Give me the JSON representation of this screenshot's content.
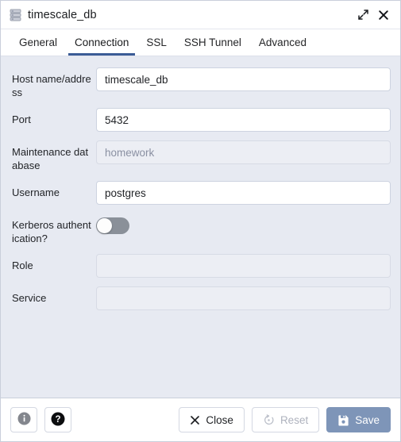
{
  "window": {
    "title": "timescale_db",
    "icon": "database-stack-icon",
    "expand_label": "expand",
    "close_label": "close"
  },
  "tabs": [
    {
      "label": "General",
      "active": false
    },
    {
      "label": "Connection",
      "active": true
    },
    {
      "label": "SSL",
      "active": false
    },
    {
      "label": "SSH Tunnel",
      "active": false
    },
    {
      "label": "Advanced",
      "active": false
    }
  ],
  "form": {
    "host": {
      "label": "Host name/address",
      "value": "timescale_db",
      "placeholder": "",
      "state": "editable"
    },
    "port": {
      "label": "Port",
      "value": "5432",
      "placeholder": "",
      "state": "editable"
    },
    "maintenance_db": {
      "label": "Maintenance database",
      "value": "",
      "placeholder": "homework",
      "state": "readonly"
    },
    "username": {
      "label": "Username",
      "value": "postgres",
      "placeholder": "",
      "state": "editable"
    },
    "kerberos": {
      "label": "Kerberos authentication?",
      "value": "off"
    },
    "role": {
      "label": "Role",
      "value": "",
      "placeholder": "",
      "state": "empty"
    },
    "service": {
      "label": "Service",
      "value": "",
      "placeholder": "",
      "state": "empty"
    }
  },
  "footer": {
    "info_label": "i",
    "help_label": "?",
    "close_label": "Close",
    "reset_label": "Reset",
    "save_label": "Save"
  },
  "colors": {
    "panel_bg": "#e7eaf2",
    "accent_tab": "#3b5c96",
    "save_button": "#7e95b8",
    "toggle_track": "#8a9099"
  }
}
